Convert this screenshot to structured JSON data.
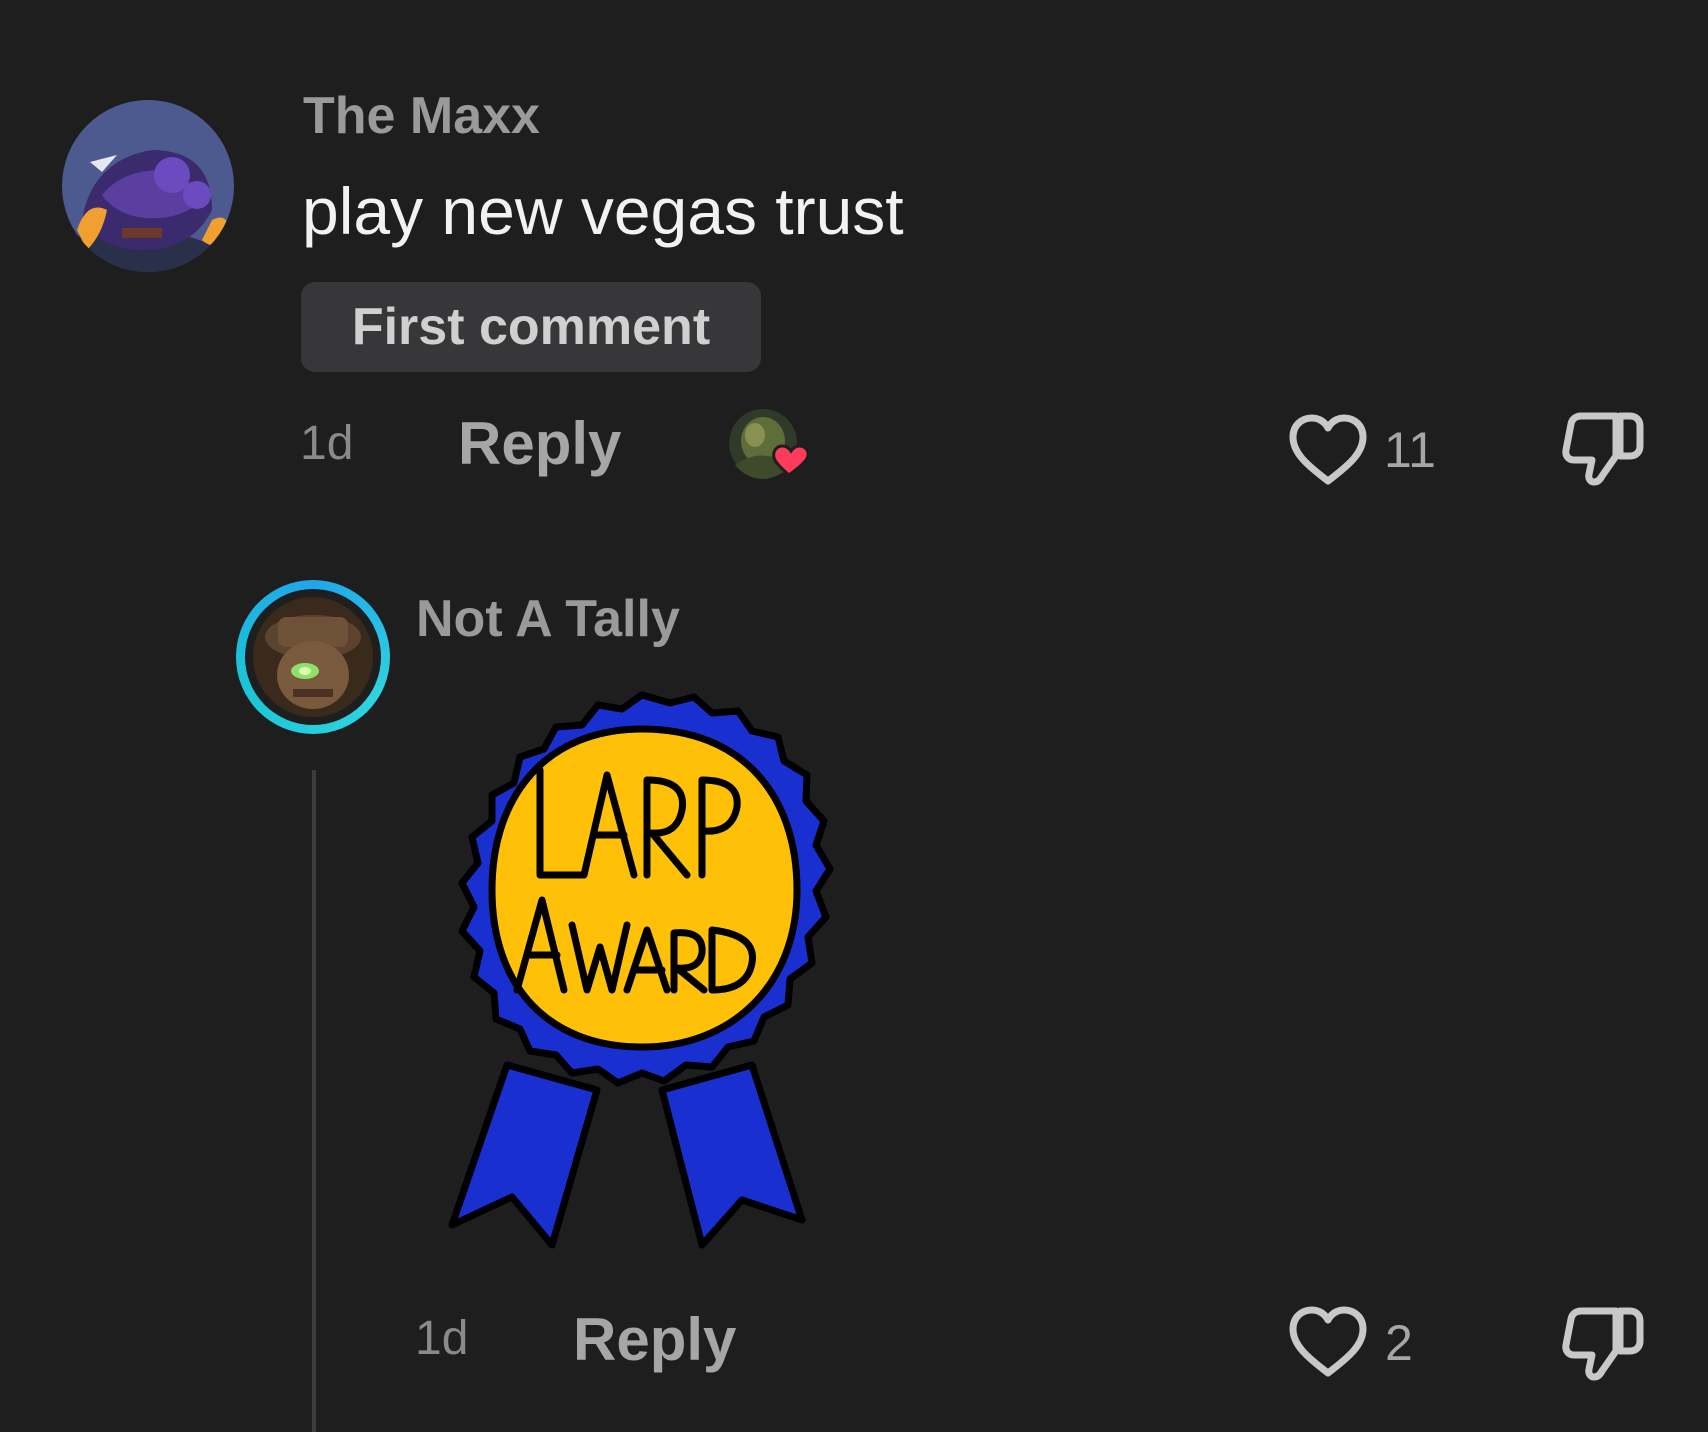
{
  "comments": [
    {
      "username": "The Maxx",
      "text": "play new vegas trust",
      "badge": "First comment",
      "time": "1d",
      "reply_label": "Reply",
      "likes": "11",
      "liked_by_creator": true
    },
    {
      "username": "Not A Tally",
      "image_caption": "LARP AWARD",
      "time": "1d",
      "reply_label": "Reply",
      "likes": "2"
    }
  ],
  "colors": {
    "background": "#1e1e1f",
    "username": "#9a9a9b",
    "heart_accent": "#ff3b5c",
    "ring": "#1fa6ea",
    "award_yellow": "#ffc107",
    "award_blue": "#1a2fd0"
  },
  "icons": [
    "heart-outline-icon",
    "thumbs-down-icon",
    "creator-heart-badge-icon"
  ]
}
